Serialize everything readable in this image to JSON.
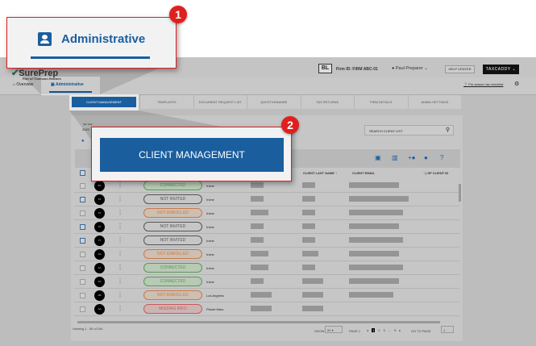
{
  "callouts": [
    {
      "number": "1",
      "label": "Administrative"
    },
    {
      "number": "2",
      "label": "CLIENT MANAGEMENT"
    }
  ],
  "header": {
    "brand": "SurePrep",
    "brand_sub": "Part of Thomson Reuters",
    "firm_logo": "BL",
    "firm_id": "Firm ID: FIRM ABC-01",
    "user": "Paul Preparer",
    "help": "HELP CENTER",
    "taxcaddy": "TAXCADDY"
  },
  "nav": {
    "overview": "Overview",
    "admin": "Administrative",
    "checklist": "Pre-season tax checklist"
  },
  "tabs": [
    "CLIENT MANAGEMENT",
    "TEMPLATES",
    "DOCUMENT REQUEST LIST",
    "QUESTIONNAIRE",
    "TAX RETURNS",
    "FIRM DETAILS",
    "ADMIN SETTINGS"
  ],
  "filters": {
    "tax_year_label": "Tax Year",
    "tax_year": "2022",
    "search_placeholder": "SEARCH CLIENT LIST"
  },
  "columns": {
    "last_name": "CLIENT LAST NAME",
    "email": "CLIENT EMAIL",
    "sp_id": "SP CLIENT ID"
  },
  "rows": [
    {
      "initials": "BS",
      "status": "CONNECTED",
      "city": "Irvine",
      "checked": false
    },
    {
      "initials": "ST",
      "status": "NOT INVITED",
      "city": "Irvine",
      "checked": true
    },
    {
      "initials": "ST",
      "status": "NOT ENROLLED",
      "city": "Irvine",
      "checked": false
    },
    {
      "initials": "TA",
      "status": "NOT INVITED",
      "city": "Irvine",
      "checked": true
    },
    {
      "initials": "TT",
      "status": "NOT INVITED",
      "city": "Irvine",
      "checked": true
    },
    {
      "initials": "AA",
      "status": "NOT ENROLLED",
      "city": "Irvine",
      "checked": false
    },
    {
      "initials": "AA",
      "status": "CONNECTED",
      "city": "Irvine",
      "checked": false
    },
    {
      "initials": "AS",
      "status": "CONNECTED",
      "city": "Irvine",
      "checked": false
    },
    {
      "initials": "AB",
      "status": "NOT ENROLLED",
      "city": "Los Angeles",
      "checked": false
    },
    {
      "initials": "AA",
      "status": "MISSING INFO",
      "city": "Planet Mars",
      "checked": false
    }
  ],
  "status_colors": {
    "CONNECTED": "#5a9a5a",
    "NOT INVITED": "#555555",
    "NOT ENROLLED": "#c77a4a",
    "MISSING INFO": "#c85a5a"
  },
  "footer": {
    "viewing": "Viewing 1 - 50 of 244",
    "show_label": "SHOW",
    "show_value": "50",
    "page_label": "PAGE 1",
    "pages": [
      "1",
      "2",
      "3",
      "...",
      "5"
    ],
    "goto_label": "GO TO PAGE",
    "goto_value": "1"
  }
}
